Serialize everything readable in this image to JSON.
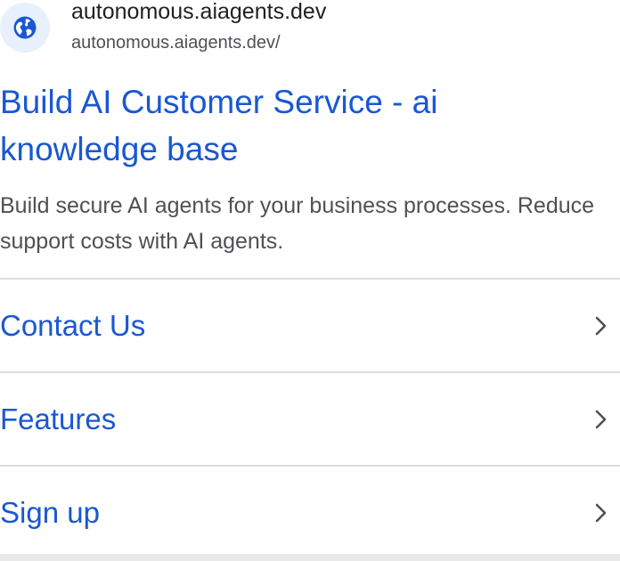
{
  "site": {
    "name": "autonomous.aiagents.dev",
    "url": "autonomous.aiagents.dev/",
    "favicon_icon": "globe-icon"
  },
  "result": {
    "title": "Build AI Customer Service - ai knowledge base",
    "snippet": "Build secure AI agents for your business processes. Reduce support costs with AI agents."
  },
  "sitelinks": [
    {
      "label": "Contact Us",
      "icon": "chevron-right-icon"
    },
    {
      "label": "Features",
      "icon": "chevron-right-icon"
    },
    {
      "label": "Sign up",
      "icon": "chevron-right-icon"
    }
  ],
  "colors": {
    "link": "#1a57d2",
    "text_primary": "#202124",
    "text_secondary": "#4d5156",
    "divider": "#dadce0",
    "favicon_bg": "#e8f0fe",
    "favicon_fg": "#1a57d2"
  }
}
